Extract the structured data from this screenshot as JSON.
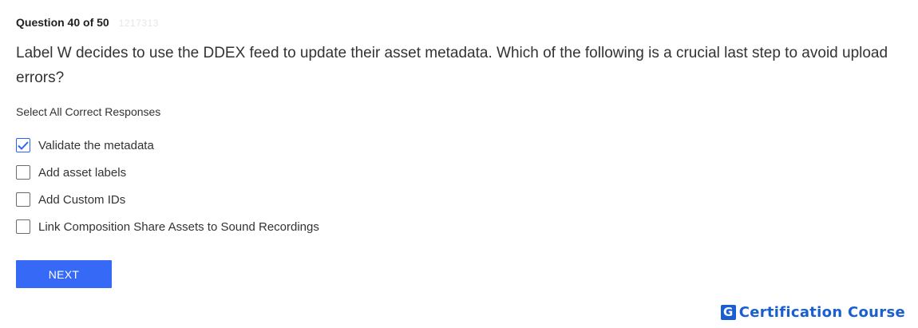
{
  "question": {
    "counter": "Question 40 of 50",
    "id": "1217313",
    "text": "Label W decides to use the DDEX feed to update their asset metadata. Which of the following is a crucial last step to avoid upload errors?",
    "instruction": "Select All Correct Responses"
  },
  "options": [
    {
      "label": "Validate the metadata",
      "checked": true
    },
    {
      "label": "Add asset labels",
      "checked": false
    },
    {
      "label": "Add Custom IDs",
      "checked": false
    },
    {
      "label": "Link Composition Share Assets to Sound Recordings",
      "checked": false
    }
  ],
  "actions": {
    "next_label": "NEXT"
  },
  "brand": {
    "logo_letter": "G",
    "name": "Certification Course"
  },
  "colors": {
    "accent": "#3669f5",
    "brand": "#1a5fd1"
  },
  "icons": {
    "checkmark": "check-icon",
    "logo": "g-logo-icon"
  }
}
